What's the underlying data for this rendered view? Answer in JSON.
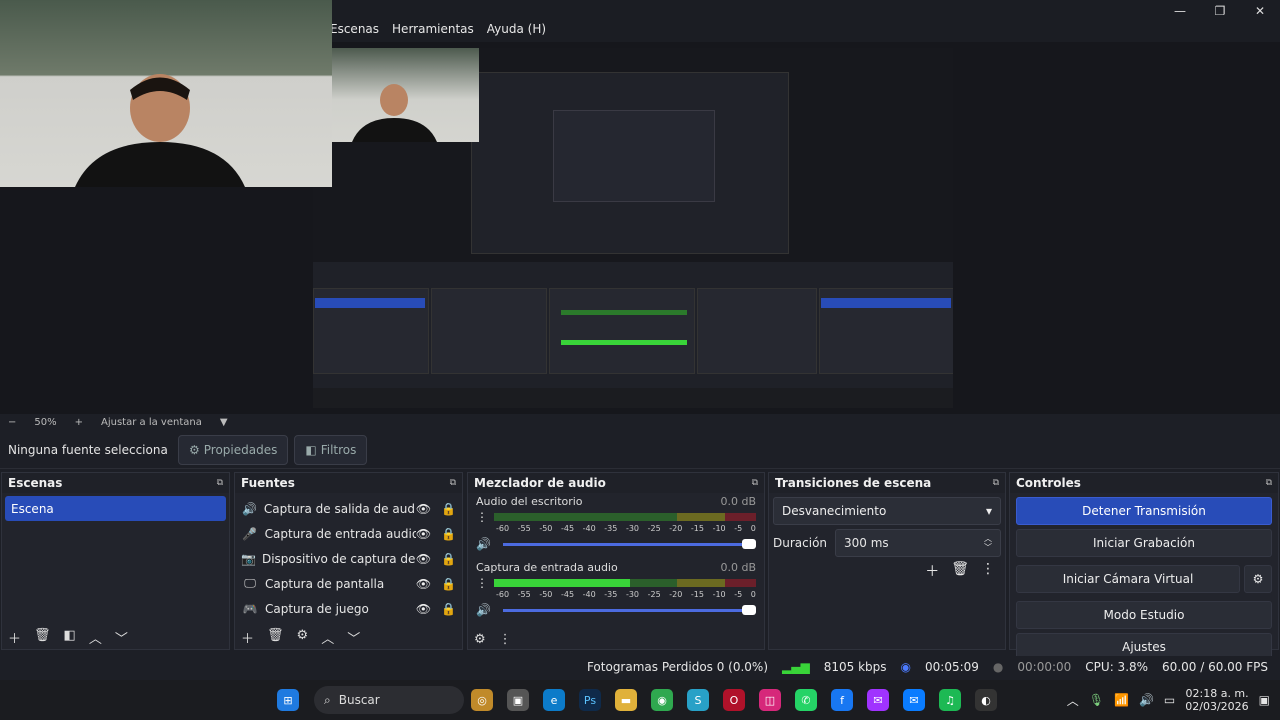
{
  "menu": {
    "items": [
      "Escenas",
      "Herramientas",
      "Ayuda (H)"
    ]
  },
  "window": {
    "min": "—",
    "max": "❐",
    "close": "✕"
  },
  "zoom": {
    "minus": "−",
    "value": "50%",
    "plus": "+",
    "fit": "Ajustar a la ventana",
    "arrow": "▼"
  },
  "source_bar": {
    "no_selection": "Ninguna fuente selecciona",
    "properties": "Propiedades",
    "filters": "Filtros"
  },
  "scenes": {
    "title": "Escenas",
    "items": [
      "Escena"
    ]
  },
  "sources": {
    "title": "Fuentes",
    "items": [
      {
        "icon": "speaker-icon",
        "glyph": "🔊",
        "label": "Captura de salida de audio"
      },
      {
        "icon": "microphone-icon",
        "glyph": "🎤",
        "label": "Captura de entrada audio"
      },
      {
        "icon": "camera-icon",
        "glyph": "📷",
        "label": "Dispositivo de captura de video"
      },
      {
        "icon": "monitor-icon",
        "glyph": "🖵",
        "label": "Captura de pantalla"
      },
      {
        "icon": "gamepad-icon",
        "glyph": "🎮",
        "label": "Captura de juego"
      }
    ]
  },
  "mixer": {
    "title": "Mezclador de audio",
    "scale": [
      "-60",
      "-55",
      "-50",
      "-45",
      "-40",
      "-35",
      "-30",
      "-25",
      "-20",
      "-15",
      "-10",
      "-5",
      "0"
    ],
    "channels": [
      {
        "name": "Audio del escritorio",
        "db": "0.0 dB",
        "level": 0.0
      },
      {
        "name": "Captura de entrada audio",
        "db": "0.0 dB",
        "level": 0.52
      }
    ]
  },
  "transitions": {
    "title": "Transiciones de escena",
    "selected": "Desvanecimiento",
    "duration_label": "Duración",
    "duration_value": "300 ms"
  },
  "controls": {
    "title": "Controles",
    "stop_stream": "Detener Transmisión",
    "start_record": "Iniciar Grabación",
    "virtual_cam": "Iniciar Cámara Virtual",
    "studio_mode": "Modo Estudio",
    "settings": "Ajustes"
  },
  "status": {
    "dropped": "Fotogramas Perdidos 0 (0.0%)",
    "bitrate": "8105 kbps",
    "stream_time": "00:05:09",
    "rec_time": "00:00:00",
    "cpu": "CPU: 3.8%",
    "fps": "60.00 / 60.00 FPS"
  },
  "taskbar": {
    "search": "Buscar",
    "time": "02:18 a. m.",
    "date": "02/03/2026"
  },
  "colors": {
    "accent": "#284cb8",
    "meter_green": "#39d439",
    "bg": "#1d1f26"
  }
}
